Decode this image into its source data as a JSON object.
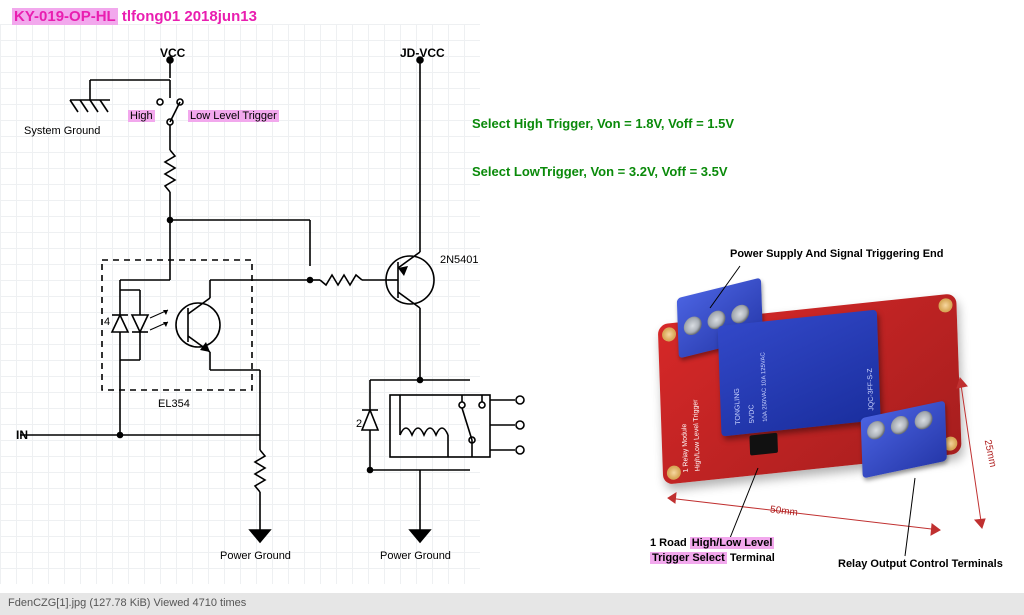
{
  "title_part1": "KY-019-OP-HL",
  "title_part2": " tlfong01 2018jun13",
  "schematic": {
    "vcc": "VCC",
    "jdvcc": "JD-VCC",
    "sys_gnd": "System Ground",
    "high": "High",
    "low_trigger": "Low Level Trigger",
    "el354": "EL354",
    "q_label": "2N5401",
    "in": "IN",
    "pin4": "4",
    "pin2": "2",
    "pg1": "Power Ground",
    "pg2": "Power Ground"
  },
  "info": {
    "high": "Select High Trigger, Von = 1.8V, Voff = 1.5V",
    "low": "Select LowTrigger, Von = 3.2V, Voff = 3.5V"
  },
  "photo": {
    "top_label": "Power Supply And Signal Triggering End",
    "jumper_l1": "1 Road ",
    "jumper_hl": "High/Low Level",
    "jumper_l2a": "Trigger Select",
    "jumper_l2b": " Terminal",
    "out_label": "Relay Output Control Terminals",
    "dim50": "50mm",
    "dim25": "25mm",
    "relay_brand": "TONGLING",
    "relay_rating": "10A 250VAC  10A 125VAC",
    "relay_dc": "5VDC",
    "relay_model": "JQC-3FF-S-Z",
    "side1": "1 Relay Module",
    "side2": "High/Low Level Trigger"
  },
  "footer": {
    "filename": "FdenCZG[1].jpg",
    "size": "(127.78 KiB)",
    "viewed": "Viewed 4710 times"
  }
}
